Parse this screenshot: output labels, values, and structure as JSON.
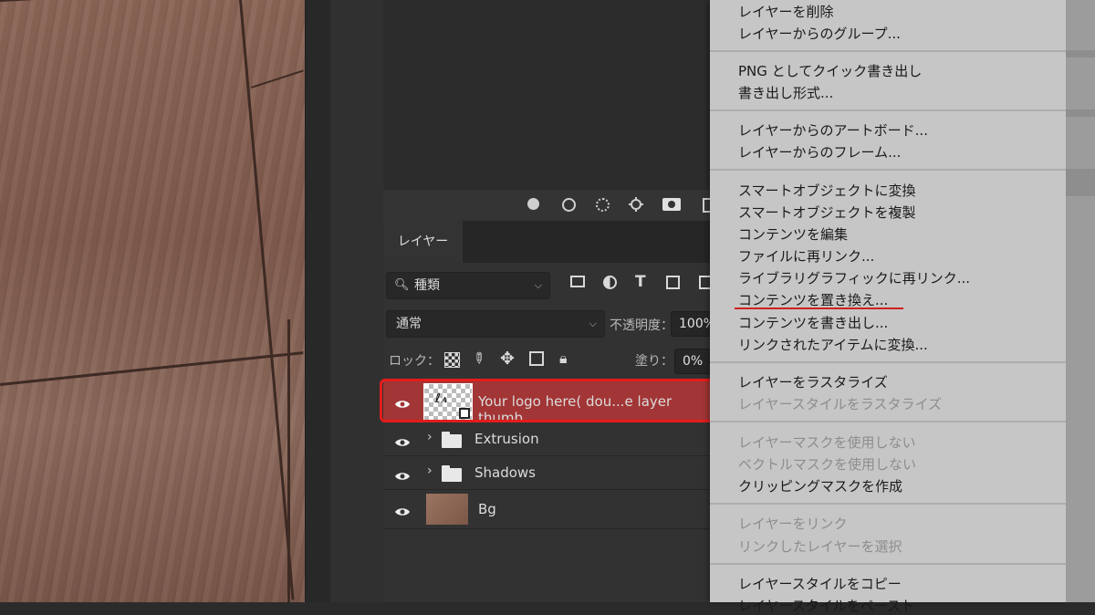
{
  "layers_panel": {
    "tab_label": "レイヤー",
    "filter": {
      "value": "種類",
      "icon": "search-icon"
    },
    "blend_mode": "通常",
    "opacity_label": "不透明度：",
    "opacity_value": "100%",
    "lock_label": "ロック：",
    "fill_label": "塗り：",
    "fill_value": "0%",
    "layers": [
      {
        "name": "Your logo here( dou...e layer thumb",
        "type": "smart-object",
        "selected": true
      },
      {
        "name": "Extrusion",
        "type": "group"
      },
      {
        "name": "Shadows",
        "type": "group"
      },
      {
        "name": "Bg",
        "type": "image"
      }
    ],
    "filter_icons": [
      "image-filter-icon",
      "adjustment-filter-icon",
      "type-filter-icon",
      "shape-filter-icon",
      "smart-object-filter-icon"
    ],
    "lock_icons": [
      "lock-transparent-icon",
      "lock-image-icon",
      "lock-position-icon",
      "lock-artboard-icon",
      "lock-all-icon"
    ]
  },
  "context_menu": {
    "groups": [
      [
        "レイヤーを削除",
        "レイヤーからのグループ..."
      ],
      [
        "PNG としてクイック書き出し",
        "書き出し形式..."
      ],
      [
        "レイヤーからのアートボード...",
        "レイヤーからのフレーム..."
      ],
      [
        "スマートオブジェクトに変換",
        "スマートオブジェクトを複製",
        "コンテンツを編集",
        "ファイルに再リンク...",
        "ライブラリグラフィックに再リンク...",
        "コンテンツを置き換え...",
        "コンテンツを書き出し...",
        "リンクされたアイテムに変換..."
      ],
      [
        "レイヤーをラスタライズ",
        "レイヤースタイルをラスタライズ"
      ],
      [
        "レイヤーマスクを使用しない",
        "ベクトルマスクを使用しない",
        "クリッピングマスクを作成"
      ],
      [
        "レイヤーをリンク",
        "リンクしたレイヤーを選択"
      ],
      [
        "レイヤースタイルをコピー",
        "レイヤースタイルをペースト"
      ]
    ]
  },
  "colors": {
    "accent_highlight": "#e41c1c",
    "selected_row": "#a23535",
    "menu_bg": "#c6c6c6"
  }
}
